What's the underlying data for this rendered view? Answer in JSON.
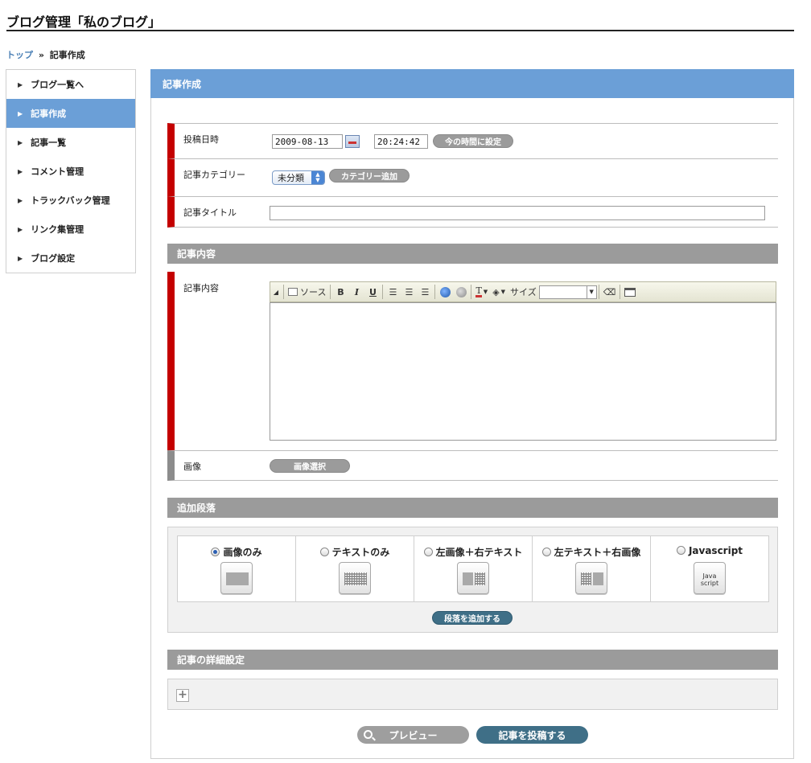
{
  "page": {
    "title": "ブログ管理「私のブログ」"
  },
  "breadcrumb": {
    "home": "トップ",
    "separator": "»",
    "current": "記事作成"
  },
  "sidebar": {
    "items": [
      {
        "label": "ブログ一覧へ",
        "active": false
      },
      {
        "label": "記事作成",
        "active": true
      },
      {
        "label": "記事一覧",
        "active": false
      },
      {
        "label": "コメント管理",
        "active": false
      },
      {
        "label": "トラックバック管理",
        "active": false
      },
      {
        "label": "リンク集管理",
        "active": false
      },
      {
        "label": "ブログ設定",
        "active": false
      }
    ]
  },
  "main": {
    "header": "記事作成"
  },
  "form": {
    "post_date_label": "投稿日時",
    "date_value": "2009-08-13",
    "time_value": "20:24:42",
    "now_button": "今の時間に設定",
    "category_label": "記事カテゴリー",
    "category_selected": "未分類",
    "add_category_button": "カテゴリー追加",
    "title_label": "記事タイトル",
    "title_value": ""
  },
  "content_section": {
    "bar_title": "記事内容",
    "label": "記事内容",
    "toolbar": {
      "source_label": "ソース",
      "bold": "B",
      "italic": "I",
      "underline": "U",
      "size_label": "サイズ",
      "size_value": ""
    },
    "image_label": "画像",
    "image_select_button": "画像選択"
  },
  "paragraph_section": {
    "bar_title": "追加段落",
    "options": [
      {
        "label": "画像のみ",
        "selected": true,
        "icon": "image-only-icon"
      },
      {
        "label": "テキストのみ",
        "selected": false,
        "icon": "text-only-icon"
      },
      {
        "label": "左画像＋右テキスト",
        "selected": false,
        "icon": "image-left-text-right-icon"
      },
      {
        "label": "左テキスト＋右画像",
        "selected": false,
        "icon": "text-left-image-right-icon"
      },
      {
        "label": "Javascript",
        "selected": false,
        "icon": "javascript-icon",
        "icon_text": "Java\nscript"
      }
    ],
    "add_button": "段落を追加する"
  },
  "detail_section": {
    "bar_title": "記事の詳細設定"
  },
  "actions": {
    "preview": "プレビュー",
    "submit": "記事を投稿する"
  },
  "colors": {
    "accent_blue": "#6b9fd7",
    "required_red": "#c40000",
    "section_grey": "#9b9b9b",
    "dark_button": "#3f6f87"
  }
}
